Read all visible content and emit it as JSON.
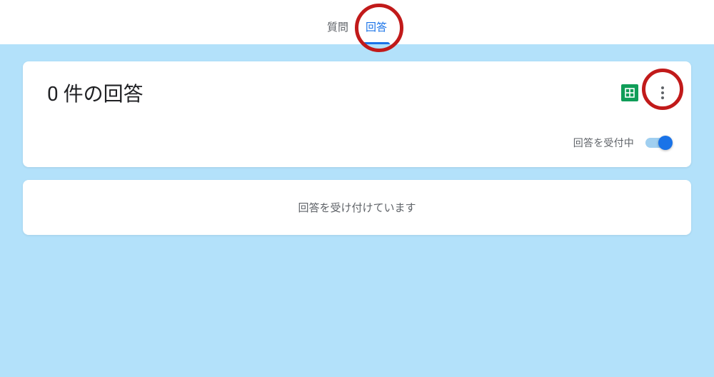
{
  "tabs": {
    "questions": "質問",
    "responses": "回答"
  },
  "responsesPanel": {
    "title": "0 件の回答",
    "acceptingToggleLabel": "回答を受付中",
    "acceptingStatus": "回答を受け付けています"
  }
}
